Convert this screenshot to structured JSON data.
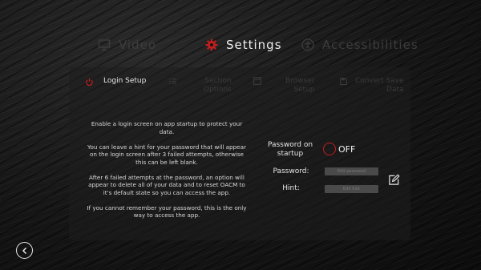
{
  "tabs": {
    "video": "Video",
    "settings": "Settings",
    "accessibilities": "Accessibilities"
  },
  "subtabs": {
    "login_setup": "Login Setup",
    "section_options_1": "Section",
    "section_options_2": "Options",
    "browser_setup_1": "Browser",
    "browser_setup_2": "Setup",
    "convert_save_1": "Convert Save",
    "convert_save_2": "Data"
  },
  "description": {
    "p1": "Enable a login screen on app startup to protect your data.",
    "p2": "You can leave a hint for your password that will appear on the login screen after 3 failed attempts, otherwise this can be left blank.",
    "p3": "After 6 failed attempts at the password, an option will appear to delete all of your data and to reset OACM to it's default state so you can access the app.",
    "p4": "If you cannot remember your password, this is the only way to access the app."
  },
  "form": {
    "startup_label": "Password on startup",
    "startup_state": "OFF",
    "password_label": "Password:",
    "password_placeholder": "Edit password",
    "hint_label": "Hint:",
    "hint_placeholder": "Edit hint"
  },
  "colors": {
    "accent": "#c21e1e",
    "inactive_text": "#3c3c3c"
  },
  "icons": {
    "video": "monitor-icon",
    "settings": "gear-icon",
    "accessibilities": "accessibility-icon",
    "login": "power-icon",
    "section": "list-icon",
    "browser": "window-icon",
    "convert": "save-icon",
    "edit": "edit-icon",
    "back": "back-arrow-icon"
  }
}
